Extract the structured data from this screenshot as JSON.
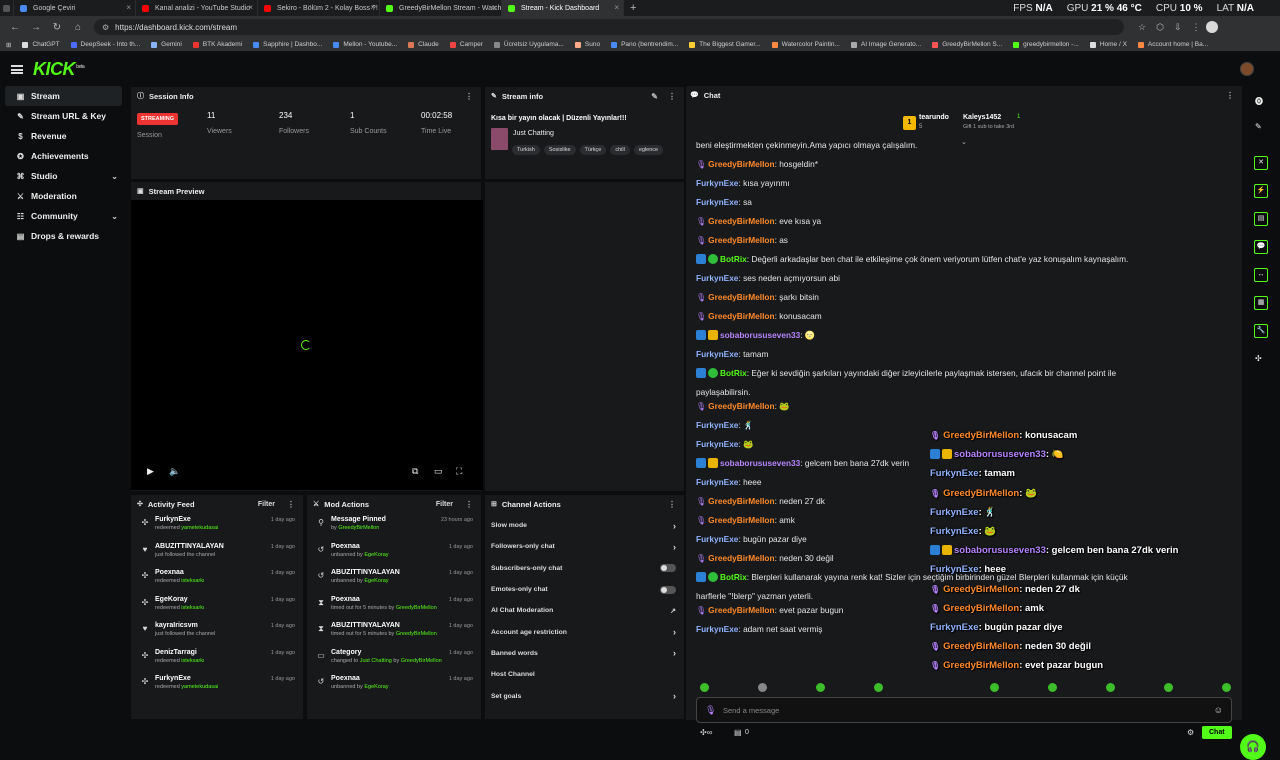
{
  "browser": {
    "tabs": [
      {
        "title": "Google Çeviri",
        "color": "#4a8af4"
      },
      {
        "title": "Kanal analizi - YouTube Studio",
        "color": "#ff0000"
      },
      {
        "title": "Sekiro - Bölüm 2 - Kolay Boss ?!",
        "color": "#ff0000"
      },
      {
        "title": "GreedyBirMellon Stream - Watch",
        "color": "#53fc18"
      },
      {
        "title": "Stream - Kick Dashboard",
        "color": "#53fc18"
      }
    ],
    "url": "https://dashboard.kick.com/stream",
    "perf": {
      "fps_label": "FPS",
      "fps": "N/A",
      "gpu_label": "GPU",
      "gpu": "21 % 46 °C",
      "cpu_label": "CPU",
      "cpu": "10 %",
      "lat_label": "LAT",
      "lat": "N/A"
    },
    "bookmarks": [
      {
        "label": "ChatGPT",
        "color": "#ddd"
      },
      {
        "label": "DeepSeek - Into th...",
        "color": "#4d6bfe"
      },
      {
        "label": "Gemini",
        "color": "#8ab4f8"
      },
      {
        "label": "BTK Akademi",
        "color": "#e33"
      },
      {
        "label": "Sapphire | Dashbo...",
        "color": "#4a8af4"
      },
      {
        "label": "Mellon - Youtube...",
        "color": "#4a8af4"
      },
      {
        "label": "Claude",
        "color": "#d97757"
      },
      {
        "label": "Camper",
        "color": "#e44"
      },
      {
        "label": "Ücretsiz Uygulama...",
        "color": "#888"
      },
      {
        "label": "Suno",
        "color": "#fa8"
      },
      {
        "label": "Pano (bentrendim...",
        "color": "#4a8af4"
      },
      {
        "label": "The Biggest Gamer...",
        "color": "#fc3"
      },
      {
        "label": "Watercolor Paintin...",
        "color": "#f84"
      },
      {
        "label": "AI Image Generato...",
        "color": "#aaa"
      },
      {
        "label": "GreedyBirMellon S...",
        "color": "#f55"
      },
      {
        "label": "greedybirmellon -...",
        "color": "#53fc18"
      },
      {
        "label": "Home / X",
        "color": "#ddd"
      },
      {
        "label": "Account home | Ba...",
        "color": "#f84"
      }
    ]
  },
  "app": {
    "logo": "KICK",
    "logo_sup": "beta"
  },
  "sidebar": {
    "items": [
      {
        "label": "Stream",
        "icon": "▣"
      },
      {
        "label": "Stream URL & Key",
        "icon": "✎"
      },
      {
        "label": "Revenue",
        "icon": "$"
      },
      {
        "label": "Achievements",
        "icon": "✪"
      },
      {
        "label": "Studio",
        "icon": "⌘"
      },
      {
        "label": "Moderation",
        "icon": "⚔"
      },
      {
        "label": "Community",
        "icon": "☷"
      },
      {
        "label": "Drops & rewards",
        "icon": "▤"
      }
    ]
  },
  "session": {
    "title": "Session Info",
    "badge": "STREAMING",
    "session_label": "Session",
    "viewers": "11",
    "viewers_label": "Viewers",
    "followers": "234",
    "followers_label": "Followers",
    "subs": "1",
    "subs_label": "Sub Counts",
    "time": "00:02:58",
    "time_label": "Time Live"
  },
  "stream_info": {
    "title": "Stream info",
    "stream_title": "Kısa bir yayın olacak | Düzenli Yayınlar!!!",
    "category": "Just Chatting",
    "tags": [
      "Turkish",
      "Sosislike",
      "Türkçe",
      "chill",
      "eglence"
    ]
  },
  "preview": {
    "title": "Stream Preview"
  },
  "activity": {
    "title": "Activity Feed",
    "filter": "Filter",
    "items": [
      {
        "icon": "✣",
        "name": "FurkynExe",
        "pre": "redeemed ",
        "hl": "yametekudasai",
        "post": "",
        "time": "1 day ago"
      },
      {
        "icon": "♥",
        "name": "ABUZITTINYALAYAN",
        "pre": "just followed the channel",
        "hl": "",
        "post": "",
        "time": "1 day ago"
      },
      {
        "icon": "✣",
        "name": "Poexnaa",
        "pre": "redeemed ",
        "hl": "isteksarkı",
        "post": "",
        "time": "1 day ago"
      },
      {
        "icon": "✣",
        "name": "EgeKoray",
        "pre": "redeemed ",
        "hl": "isteksarkı",
        "post": "",
        "time": "1 day ago"
      },
      {
        "icon": "♥",
        "name": "kayraIricsvm",
        "pre": "just followed the channel",
        "hl": "",
        "post": "",
        "time": "1 day ago"
      },
      {
        "icon": "✣",
        "name": "DenizTarragi",
        "pre": "redeemed ",
        "hl": "isteksarkı",
        "post": "",
        "time": "1 day ago"
      },
      {
        "icon": "✣",
        "name": "FurkynExe",
        "pre": "redeemed ",
        "hl": "yametekudasai",
        "post": "",
        "time": "1 day ago"
      }
    ]
  },
  "mod_actions": {
    "title": "Mod Actions",
    "filter": "Filter",
    "items": [
      {
        "icon": "⚲",
        "name": "Message Pinned",
        "pre": "by ",
        "hl": "GreedyBirMellon",
        "mid": "",
        "hl2": "",
        "time": "23 hours ago"
      },
      {
        "icon": "↺",
        "name": "Poexnaa",
        "pre": "unbanned by ",
        "hl": "EgeKoray",
        "mid": "",
        "hl2": "",
        "time": "1 day ago"
      },
      {
        "icon": "↺",
        "name": "ABUZITTINYALAYAN",
        "pre": "unbanned by ",
        "hl": "EgeKoray",
        "mid": "",
        "hl2": "",
        "time": "1 day ago"
      },
      {
        "icon": "⧗",
        "name": "Poexnaa",
        "pre": "timed out for 5 minutes by ",
        "hl": "GreedyBirMellon",
        "mid": "",
        "hl2": "",
        "time": "1 day ago"
      },
      {
        "icon": "⧗",
        "name": "ABUZITTINYALAYAN",
        "pre": "timed out for 5 minutes by ",
        "hl": "GreedyBirMellon",
        "mid": "",
        "hl2": "",
        "time": "1 day ago"
      },
      {
        "icon": "▭",
        "name": "Category",
        "pre": "changed to ",
        "hl": "Just Chatting",
        "mid": " by ",
        "hl2": "GreedyBirMellon",
        "time": "1 day ago"
      },
      {
        "icon": "↺",
        "name": "Poexnaa",
        "pre": "unbanned by ",
        "hl": "EgeKoray",
        "mid": "",
        "hl2": "",
        "time": "1 day ago"
      }
    ]
  },
  "channel_actions": {
    "title": "Channel Actions",
    "items": [
      {
        "label": "Slow mode",
        "ctrl": "chevron"
      },
      {
        "label": "Followers-only chat",
        "ctrl": "chevron"
      },
      {
        "label": "Subscribers-only chat",
        "ctrl": "toggle"
      },
      {
        "label": "Emotes-only chat",
        "ctrl": "toggle"
      },
      {
        "label": "AI Chat Moderation",
        "ctrl": "external"
      },
      {
        "label": "Account age restriction",
        "ctrl": "chevron"
      },
      {
        "label": "Banned words",
        "ctrl": "chevron"
      },
      {
        "label": "Host Channel",
        "ctrl": "none"
      },
      {
        "label": "Set goals",
        "ctrl": "chevron"
      }
    ]
  },
  "chat": {
    "title": "Chat",
    "leader1_name": "tearundo",
    "leader1_badge": "5",
    "leader2_name": "Kaleys1452",
    "leader2_badge": "1",
    "leader2_sub": "Gift 1 sub to take 3rd",
    "messages": [
      {
        "user": "",
        "cls": "",
        "text": "beni eleştirmekten çekinmeyin.Ama yapıcı olmaya çalışalım.",
        "badges": ""
      },
      {
        "user": "GreedyBirMellon",
        "cls": "u-o",
        "text": "hosgeldin*",
        "badges": "mic"
      },
      {
        "user": "FurkynExe",
        "cls": "u-b",
        "text": "kısa yayınmı",
        "badges": ""
      },
      {
        "user": "FurkynExe",
        "cls": "u-b",
        "text": "sa",
        "badges": ""
      },
      {
        "user": "GreedyBirMellon",
        "cls": "u-o",
        "text": "eve kısa ya",
        "badges": "mic"
      },
      {
        "user": "GreedyBirMellon",
        "cls": "u-o",
        "text": "as",
        "badges": "mic"
      },
      {
        "user": "BotRix",
        "cls": "u-g",
        "text": "Değerli arkadaşlar ben chat ile etkileşime çok önem veriyorum lütfen chat'e yaz konuşalım kaynaşalım.",
        "badges": "bot"
      },
      {
        "user": "FurkynExe",
        "cls": "u-b",
        "text": "ses neden açmıyorsun abi",
        "badges": ""
      },
      {
        "user": "GreedyBirMellon",
        "cls": "u-o",
        "text": "şarkı bitsin",
        "badges": "mic"
      },
      {
        "user": "GreedyBirMellon",
        "cls": "u-o",
        "text": "konusacam",
        "badges": "mic"
      },
      {
        "user": "sobaborususeven33",
        "cls": "u-p",
        "text": "🌝",
        "badges": "sub"
      },
      {
        "user": "FurkynExe",
        "cls": "u-b",
        "text": "tamam",
        "badges": ""
      },
      {
        "user": "BotRix",
        "cls": "u-g",
        "text": "Eğer ki sevdiğin şarkıları yayındaki diğer izleyicilerle paylaşmak istersen, ufacık bir channel point ile",
        "badges": "bot"
      },
      {
        "user": "",
        "cls": "",
        "text": "paylaşabilirsin.",
        "badges": ""
      },
      {
        "user": "GreedyBirMellon",
        "cls": "u-o",
        "text": "🐸",
        "badges": "mic"
      },
      {
        "user": "FurkynExe",
        "cls": "u-b",
        "text": "🕺",
        "badges": ""
      },
      {
        "user": "FurkynExe",
        "cls": "u-b",
        "text": "🐸",
        "badges": ""
      },
      {
        "user": "sobaborususeven33",
        "cls": "u-p",
        "text": "gelcem ben bana 27dk verin",
        "badges": "sub"
      },
      {
        "user": "FurkynExe",
        "cls": "u-b",
        "text": "heee",
        "badges": ""
      },
      {
        "user": "GreedyBirMellon",
        "cls": "u-o",
        "text": "neden 27 dk",
        "badges": "mic"
      },
      {
        "user": "GreedyBirMellon",
        "cls": "u-o",
        "text": "amk",
        "badges": "mic"
      },
      {
        "user": "FurkynExe",
        "cls": "u-b",
        "text": "bugün pazar diye",
        "badges": ""
      },
      {
        "user": "GreedyBirMellon",
        "cls": "u-o",
        "text": "neden 30 değil",
        "badges": "mic"
      },
      {
        "user": "BotRix",
        "cls": "u-g",
        "text": "Blerpleri kullanarak yayına renk kat! Sizler için seçtiğim birbirinden güzel Blerpleri kullanmak için küçük",
        "badges": "bot"
      },
      {
        "user": "",
        "cls": "",
        "text": "harflerle \"!blerp\" yazman yeterli.",
        "badges": ""
      },
      {
        "user": "GreedyBirMellon",
        "cls": "u-o",
        "text": "evet pazar bugun",
        "badges": "mic"
      },
      {
        "user": "FurkynExe",
        "cls": "u-b",
        "text": "adam net saat vermiş",
        "badges": ""
      }
    ],
    "overlay": [
      {
        "user": "GreedyBirMellon",
        "cls": "o",
        "text": ": konusacam",
        "badges": "mic"
      },
      {
        "user": "sobaborususeven33",
        "cls": "p",
        "text": ": 🍋",
        "badges": "sub"
      },
      {
        "user": "FurkynExe",
        "cls": "b",
        "text": ": tamam",
        "badges": ""
      },
      {
        "user": "GreedyBirMellon",
        "cls": "o",
        "text": ": 🐸",
        "badges": "mic"
      },
      {
        "user": "FurkynExe",
        "cls": "b",
        "text": ": 🕺",
        "badges": ""
      },
      {
        "user": "FurkynExe",
        "cls": "b",
        "text": ": 🐸",
        "badges": ""
      },
      {
        "user": "sobaborususeven33",
        "cls": "p",
        "text": ": gelcem ben bana 27dk verin",
        "badges": "sub"
      },
      {
        "user": "FurkynExe",
        "cls": "b",
        "text": ": heee",
        "badges": ""
      },
      {
        "user": "GreedyBirMellon",
        "cls": "o",
        "text": ": neden 27 dk",
        "badges": "mic"
      },
      {
        "user": "GreedyBirMellon",
        "cls": "o",
        "text": ": amk",
        "badges": "mic"
      },
      {
        "user": "FurkynExe",
        "cls": "b",
        "text": ": bugün pazar diye",
        "badges": ""
      },
      {
        "user": "GreedyBirMellon",
        "cls": "o",
        "text": ": neden 30 değil",
        "badges": "mic"
      },
      {
        "user": "GreedyBirMellon",
        "cls": "o",
        "text": ": evet pazar bugun",
        "badges": "mic"
      }
    ],
    "input_placeholder": "Send a message",
    "points": "0",
    "send_label": "Chat"
  },
  "colors": {
    "accent": "#53fc18",
    "live": "#e33333"
  }
}
